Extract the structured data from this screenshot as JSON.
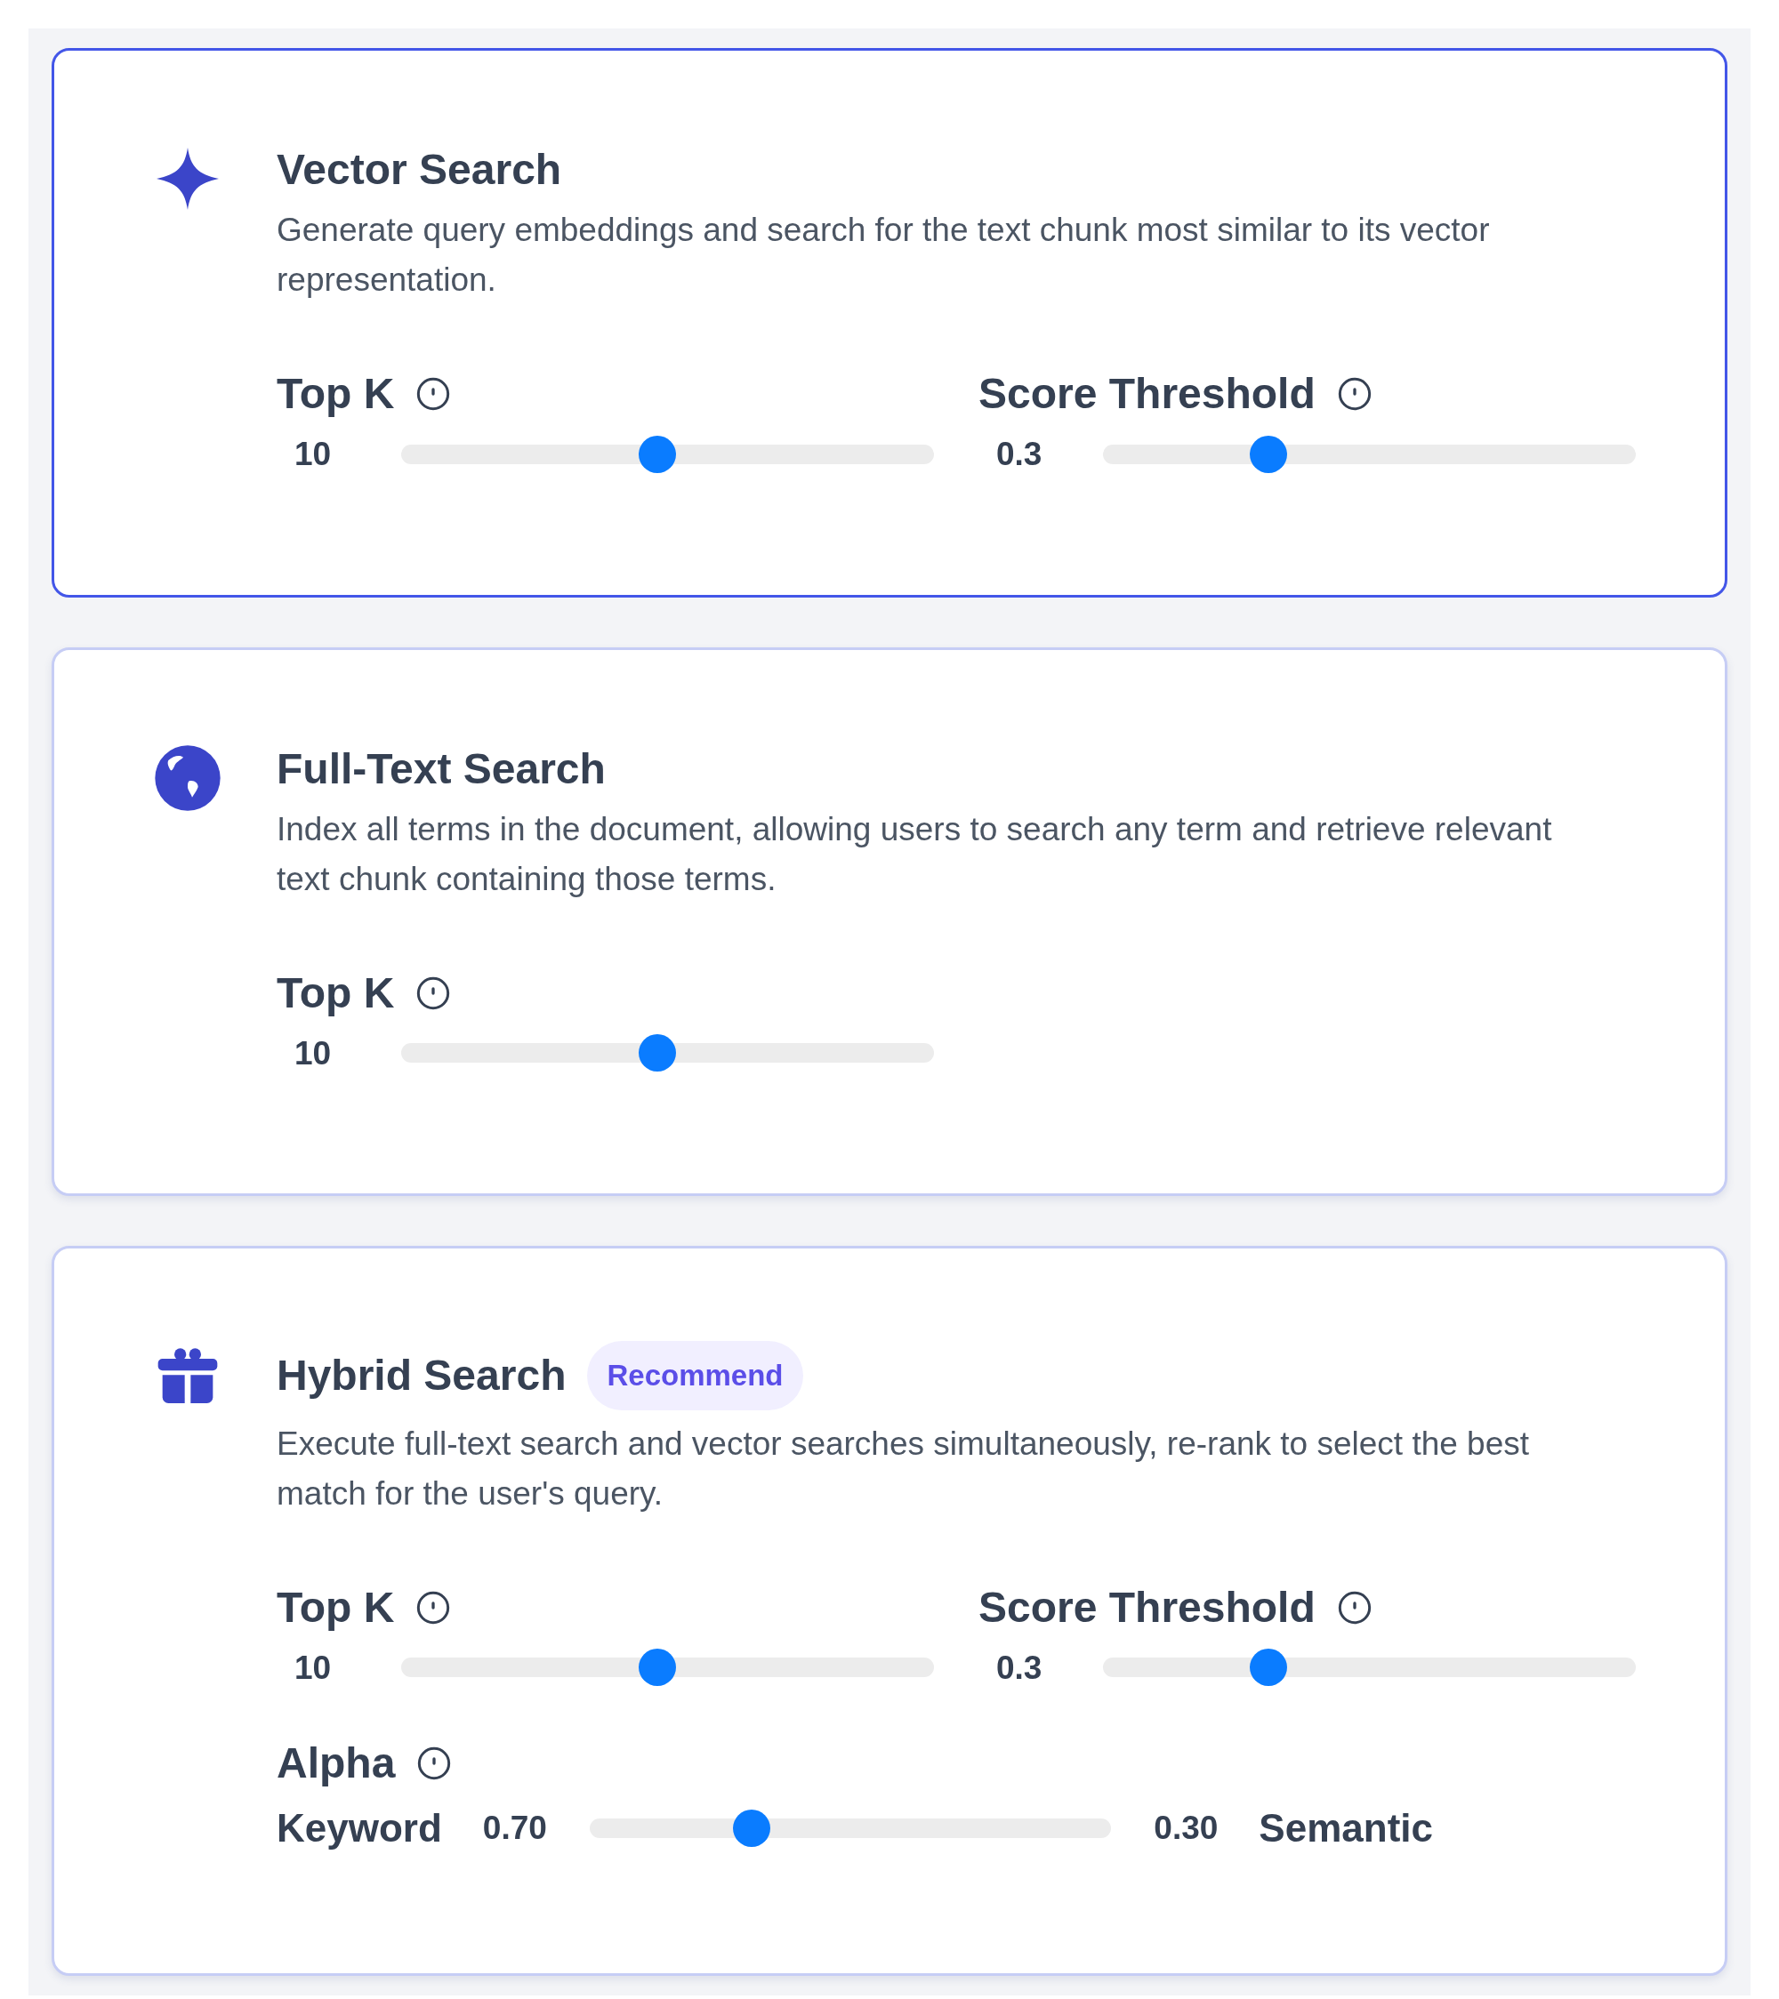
{
  "cards": [
    {
      "kind": "vector",
      "title": "Vector Search",
      "selected": true,
      "description": "Generate query embeddings and search for the text chunk most similar to its vector representation.",
      "sliders": [
        {
          "kind": "range",
          "label": "Top K",
          "value": "10",
          "level": 0.48
        },
        {
          "kind": "range",
          "label": "Score Threshold",
          "value": "0.3",
          "level": 0.31
        }
      ]
    },
    {
      "kind": "fulltext",
      "title": "Full-Text Search",
      "selected": false,
      "description": "Index all terms in the document, allowing users to search any term and retrieve relevant text chunk containing those terms.",
      "sliders": [
        {
          "kind": "range",
          "label": "Top K",
          "value": "10",
          "level": 0.48
        }
      ]
    },
    {
      "kind": "hybrid",
      "title": "Hybrid Search",
      "badge": "Recommend",
      "selected": false,
      "description": "Execute full-text search and vector searches simultaneously, re-rank to select the best match for the user's query.",
      "sliders": [
        {
          "kind": "range",
          "label": "Top K",
          "value": "10",
          "level": 0.48
        },
        {
          "kind": "range",
          "label": "Score Threshold",
          "value": "0.3",
          "level": 0.31
        },
        {
          "kind": "balance",
          "label": "Alpha",
          "left_label": "Keyword",
          "value": "0.70",
          "right_value": "0.30",
          "right_label": "Semantic",
          "level": 0.31
        }
      ]
    }
  ]
}
